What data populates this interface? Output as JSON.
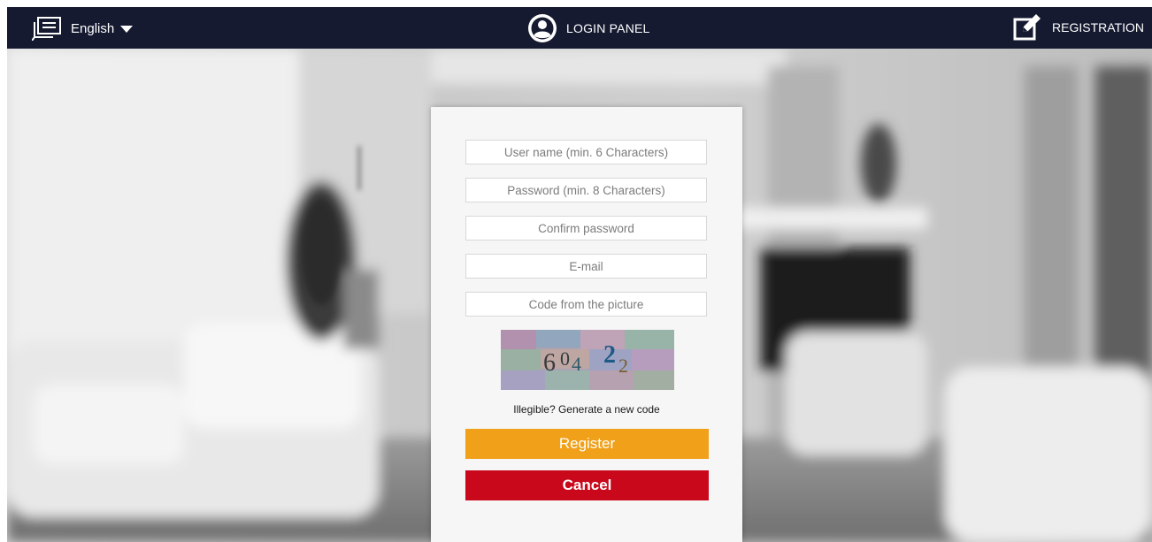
{
  "header": {
    "language": "English",
    "login_panel": "LOGIN PANEL",
    "registration": "REGISTRATION"
  },
  "form": {
    "username_placeholder": "User name (min. 6 Characters)",
    "password_placeholder": "Password (min. 8 Characters)",
    "confirm_placeholder": "Confirm password",
    "email_placeholder": "E-mail",
    "code_placeholder": "Code from the picture",
    "captcha_code": "60422",
    "new_code_link": "Illegible? Generate a new code",
    "register_label": "Register",
    "cancel_label": "Cancel"
  },
  "colors": {
    "header_bg": "#151a30",
    "register_bg": "#f0a019",
    "cancel_bg": "#c9081c"
  }
}
